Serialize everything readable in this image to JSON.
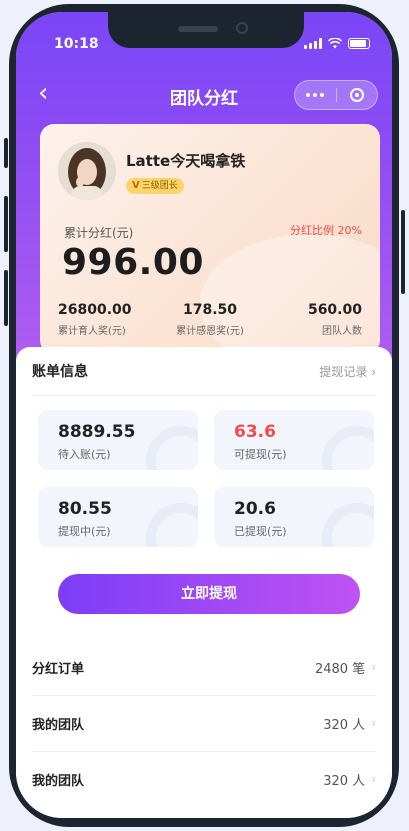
{
  "status_bar": {
    "time": "10:18"
  },
  "nav": {
    "back_icon": "‹",
    "title": "团队分红"
  },
  "profile": {
    "name": "Latte今天喝拿铁",
    "badge_mark": "V",
    "badge": "三级团长",
    "cumulative_label": "累计分红(元)",
    "ratio": "分红比例 20%",
    "amount": "996.00",
    "stats": [
      {
        "value": "26800.00",
        "label": "累计育人奖(元)"
      },
      {
        "value": "178.50",
        "label": "累计感恩奖(元)"
      },
      {
        "value": "560.00",
        "label": "团队人数"
      }
    ]
  },
  "bill": {
    "title": "账单信息",
    "records_link": "提现记录 ›",
    "tiles": [
      {
        "value": "8889.55",
        "label": "待入账(元)",
        "color": "#222222"
      },
      {
        "value": "63.6",
        "label": "可提现(元)",
        "color": "#f04c4c"
      },
      {
        "value": "80.55",
        "label": "提现中(元)",
        "color": "#222222"
      },
      {
        "value": "20.6",
        "label": "已提现(元)",
        "color": "#222222"
      }
    ],
    "withdraw_button": "立即提现"
  },
  "list": [
    {
      "label": "分红订单",
      "value": "2480 笔"
    },
    {
      "label": "我的团队",
      "value": "320 人"
    },
    {
      "label": "我的团队",
      "value": "320 人"
    }
  ],
  "colors": {
    "accent": "#7b3ef6",
    "accent2": "#c052f3",
    "highlight": "#f04c4c"
  }
}
